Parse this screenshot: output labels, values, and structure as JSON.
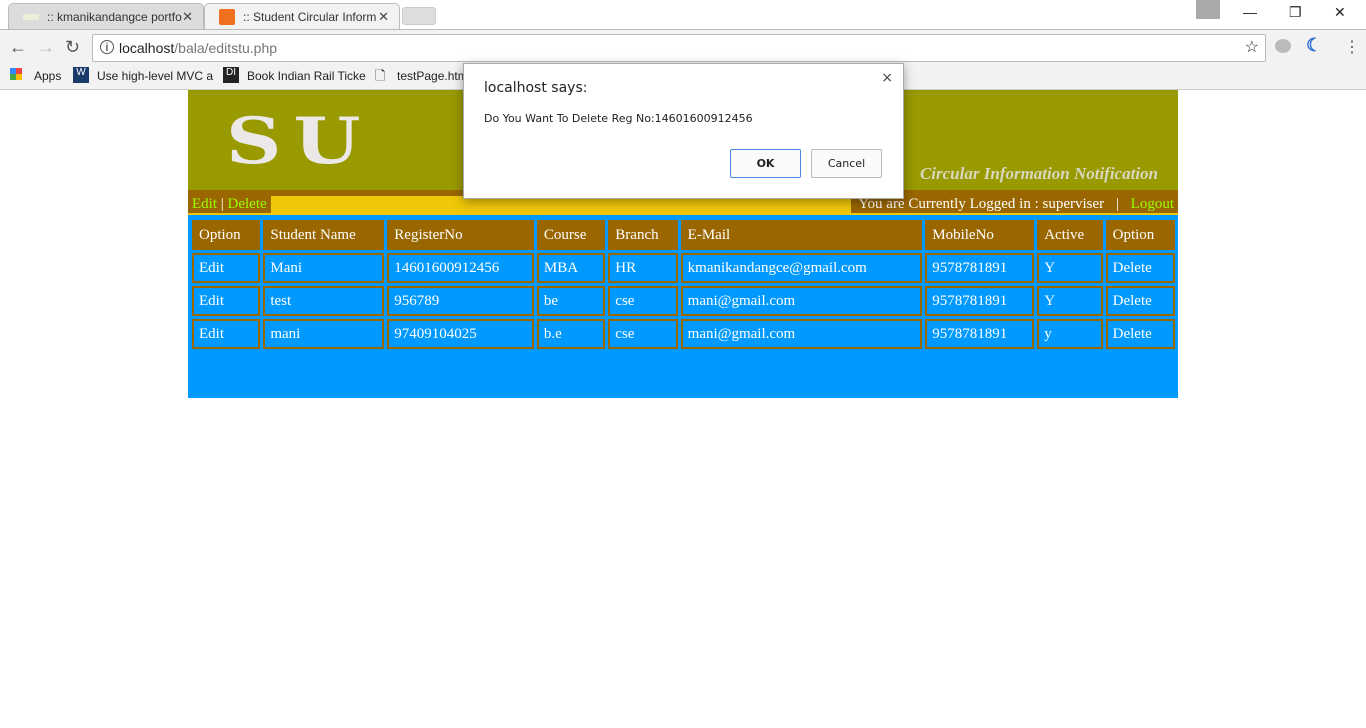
{
  "browser": {
    "tabs": [
      {
        "label": ":: kmanikandangce portfo",
        "close": "✕"
      },
      {
        "label": ":: Student Circular Inform",
        "close": "✕"
      }
    ],
    "url_host": "localhost",
    "url_path": "/bala/editstu.php",
    "bookmarks": [
      "Apps",
      "Use high-level MVC a",
      "Book Indian Rail Ticke",
      "testPage.htm"
    ]
  },
  "header": {
    "logo": "SU",
    "subtitle": "Circular Information Notification"
  },
  "menu": {
    "edit": "Edit",
    "sep": "|",
    "delete": "Delete",
    "logged_in": "You are Currently Logged in : superviser",
    "logout": "Logout"
  },
  "table": {
    "headers": [
      "Option",
      "Student Name",
      "RegisterNo",
      "Course",
      "Branch",
      "E-Mail",
      "MobileNo",
      "Active",
      "Option"
    ],
    "rows": [
      [
        "Edit",
        "Mani",
        "14601600912456",
        "MBA",
        "HR",
        "kmanikandangce@gmail.com",
        "9578781891",
        "Y",
        "Delete"
      ],
      [
        "Edit",
        "test",
        "956789",
        "be",
        "cse",
        "mani@gmail.com",
        "9578781891",
        "Y",
        "Delete"
      ],
      [
        "Edit",
        "mani",
        "97409104025",
        "b.e",
        "cse",
        "mani@gmail.com",
        "9578781891",
        "y",
        "Delete"
      ]
    ]
  },
  "dialog": {
    "title": "localhost says:",
    "message": "Do You Want To Delete Reg No:14601600912456",
    "ok": "OK",
    "cancel": "Cancel",
    "close": "×"
  }
}
